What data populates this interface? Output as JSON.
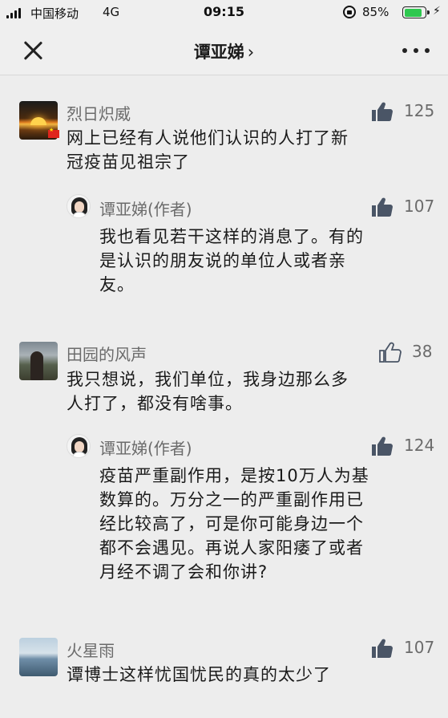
{
  "status_bar": {
    "carrier": "中国移动",
    "network": "4G",
    "time": "09:15",
    "battery_percent": "85%",
    "battery_level": 0.85,
    "icons": [
      "signal-icon",
      "rotation-lock-icon",
      "battery-icon",
      "charging-icon"
    ]
  },
  "nav": {
    "title": "谭亚娣",
    "chevron": "›",
    "icons": [
      "close-icon",
      "more-icon"
    ]
  },
  "comments": [
    {
      "name": "烈日炽威",
      "likes": "125",
      "liked": true,
      "text_lines": [
        "网上已经有人说他们认识的人打了新",
        "冠疫苗见祖宗了"
      ],
      "reply": {
        "name": "谭亚娣(作者)",
        "likes": "107",
        "liked": true,
        "text_lines": [
          "我也看见若干这样的消息了。有的",
          "是认识的朋友说的单位人或者亲",
          "友。"
        ]
      }
    },
    {
      "name": "田园的风声",
      "likes": "38",
      "liked": false,
      "text_lines": [
        "我只想说，我们单位，我身边那么多",
        "人打了，都没有啥事。"
      ],
      "reply": {
        "name": "谭亚娣(作者)",
        "likes": "124",
        "liked": true,
        "text_lines": [
          "疫苗严重副作用，是按10万人为基",
          "数算的。万分之一的严重副作用已",
          "经比较高了，可是你可能身边一个",
          "都不会遇见。再说人家阳痿了或者",
          "月经不调了会和你讲?"
        ]
      }
    },
    {
      "name": "火星雨",
      "likes": "107",
      "liked": true,
      "text_lines": [
        "谭博士这样忧国忧民的真的太少了"
      ]
    }
  ],
  "colors": {
    "background": "#ededed",
    "like_active": "#4a5566",
    "name_gray": "#6b6b6b",
    "battery_green": "#2ec84f"
  }
}
